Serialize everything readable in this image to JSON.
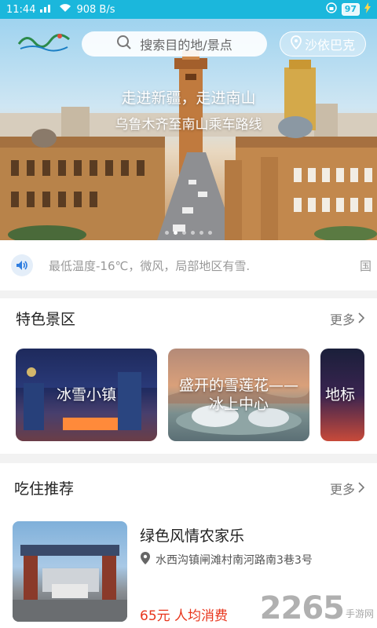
{
  "status_bar": {
    "time": "11:44",
    "network_speed": "908 B/s",
    "battery": "97"
  },
  "hero": {
    "search_placeholder": "搜索目的地/景点",
    "location": "沙依巴克",
    "title": "走进新疆，走进南山",
    "subtitle": "乌鲁木齐至南山乘车路线"
  },
  "notice": {
    "text": "最低温度-16℃，微风，局部地区有雪.",
    "overflow_char": "国"
  },
  "featured": {
    "title": "特色景区",
    "more": "更多",
    "cards": [
      {
        "label": "冰雪小镇"
      },
      {
        "label": "盛开的雪莲花——冰上中心"
      },
      {
        "label": "地标"
      }
    ]
  },
  "dining": {
    "title": "吃住推荐",
    "more": "更多",
    "items": [
      {
        "name": "绿色风情农家乐",
        "address": "水西沟镇闸滩村南河路南3巷3号",
        "price": "65元 人均消费"
      }
    ]
  },
  "watermark": {
    "number": "2265",
    "tag": "手游网"
  },
  "colors": {
    "accent": "#1bb7dc",
    "price": "#e8351c"
  }
}
